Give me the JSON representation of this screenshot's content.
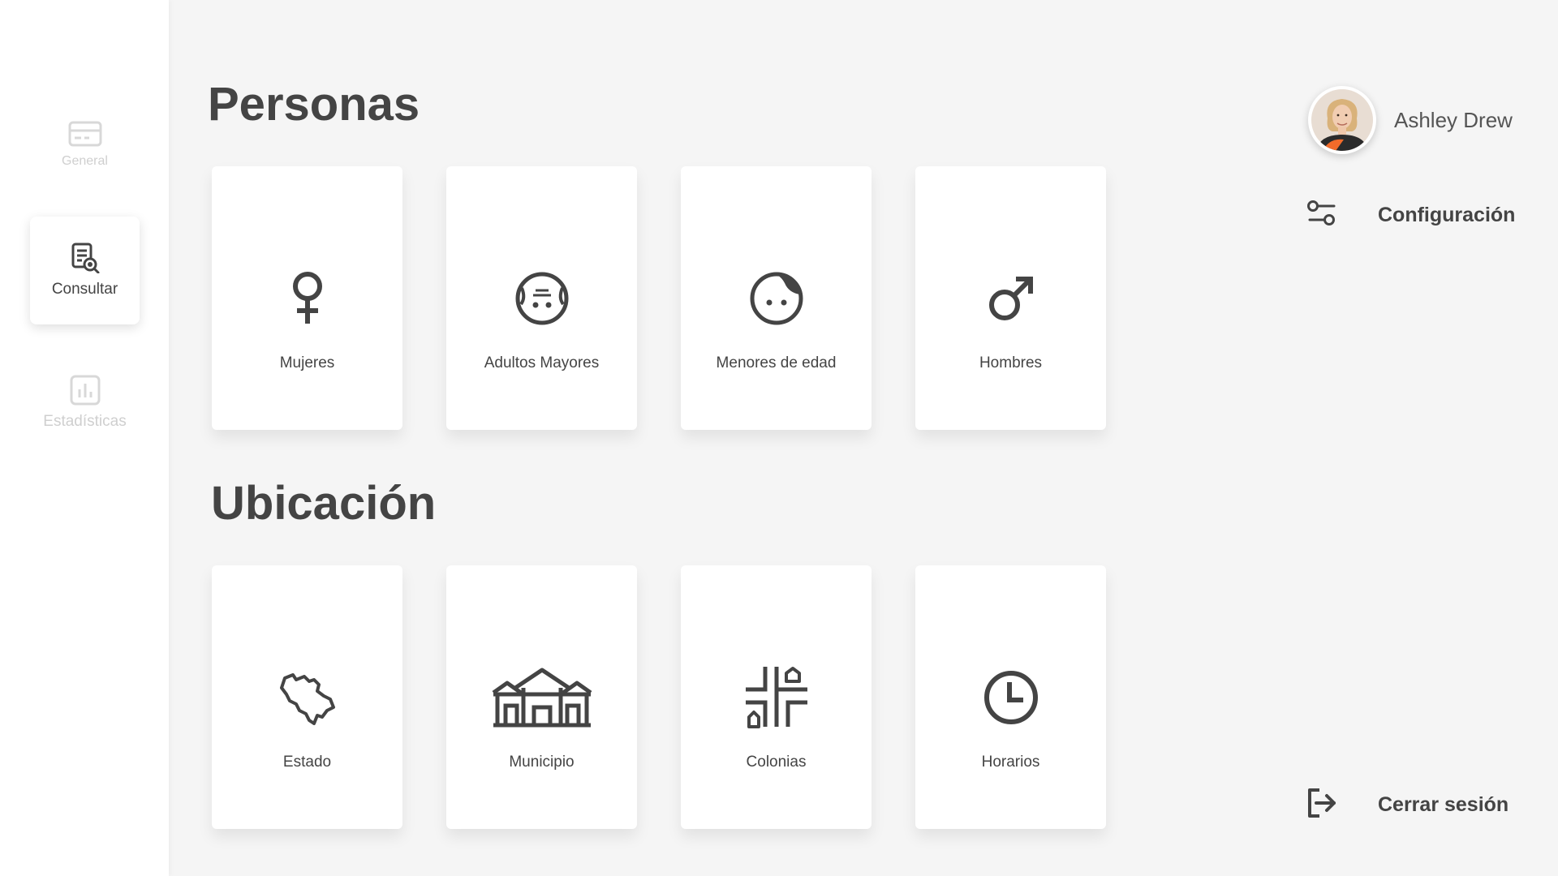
{
  "sidebar": {
    "items": [
      {
        "label": "General",
        "icon": "credit-card-icon",
        "state": "inactive"
      },
      {
        "label": "Consultar",
        "icon": "document-search-icon",
        "state": "active"
      },
      {
        "label": "Estadísticas",
        "icon": "bar-chart-icon",
        "state": "inactive"
      }
    ]
  },
  "sections": [
    {
      "title": "Personas",
      "cards": [
        {
          "label": "Mujeres",
          "icon": "female-symbol-icon"
        },
        {
          "label": "Adultos Mayores",
          "icon": "elderly-face-icon"
        },
        {
          "label": "Menores de edad",
          "icon": "child-face-icon"
        },
        {
          "label": "Hombres",
          "icon": "male-symbol-icon"
        }
      ]
    },
    {
      "title": "Ubicación",
      "cards": [
        {
          "label": "Estado",
          "icon": "state-map-icon"
        },
        {
          "label": "Municipio",
          "icon": "municipal-building-icon"
        },
        {
          "label": "Colonias",
          "icon": "neighborhood-streets-icon"
        },
        {
          "label": "Horarios",
          "icon": "clock-icon"
        }
      ]
    }
  ],
  "profile": {
    "name": "Ashley Drew",
    "avatar": "user-avatar"
  },
  "actions": {
    "settings_label": "Configuración",
    "logout_label": "Cerrar sesión"
  },
  "colors": {
    "background": "#f5f5f5",
    "text": "#444444",
    "inactive": "#cfcfcf",
    "card": "#ffffff",
    "avatar_accent": "#f26b2a"
  }
}
